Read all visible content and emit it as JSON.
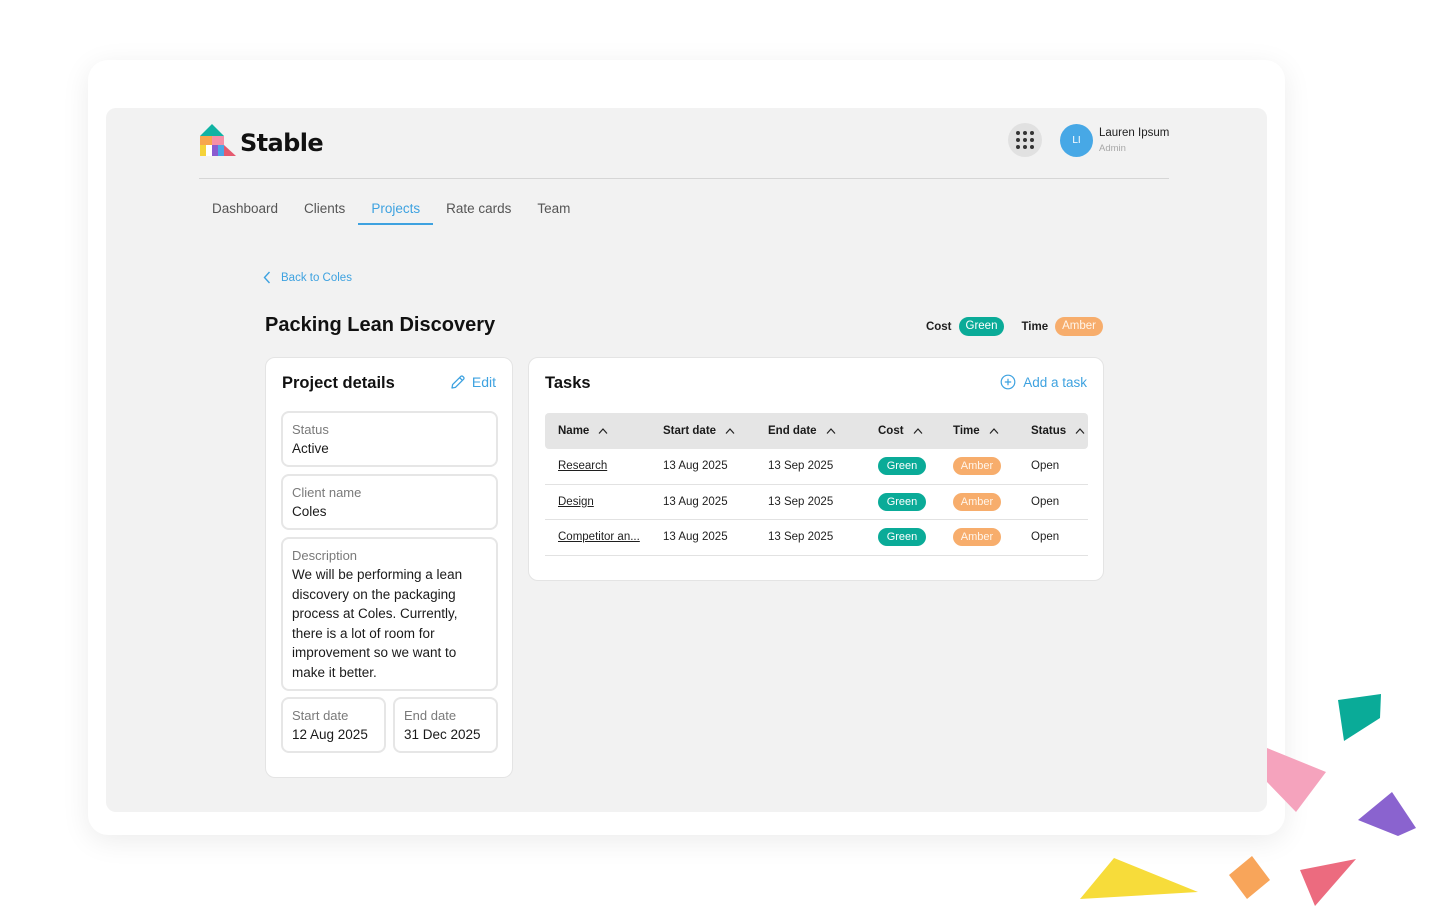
{
  "brand": {
    "name": "Stable",
    "colors": {
      "blue": "#3ea2e0",
      "green": "#0aab98",
      "amber": "#f7ad6c"
    }
  },
  "header": {
    "apps_icon": "grid-dots-icon",
    "user": {
      "initials": "LI",
      "name": "Lauren Ipsum",
      "role": "Admin"
    }
  },
  "nav": {
    "items": [
      {
        "label": "Dashboard",
        "active": false
      },
      {
        "label": "Clients",
        "active": false
      },
      {
        "label": "Projects",
        "active": true
      },
      {
        "label": "Rate cards",
        "active": false
      },
      {
        "label": "Team",
        "active": false
      }
    ]
  },
  "breadcrumb": {
    "back_label": "Back to Coles",
    "icon": "chevron-left-icon"
  },
  "project": {
    "title": "Packing Lean Discovery",
    "rag": {
      "cost_label": "Cost",
      "cost_value": "Green",
      "time_label": "Time",
      "time_value": "Amber"
    }
  },
  "details": {
    "title": "Project details",
    "edit_label": "Edit",
    "edit_icon": "pencil-icon",
    "status": {
      "label": "Status",
      "value": "Active"
    },
    "client": {
      "label": "Client name",
      "value": "Coles"
    },
    "description": {
      "label": "Description",
      "value": "We will be performing a lean discovery on the packaging process at Coles. Currently, there is a lot of room for improvement so we want to make it better."
    },
    "start_date": {
      "label": "Start date",
      "value": "12 Aug 2025"
    },
    "end_date": {
      "label": "End date",
      "value": "31 Dec 2025"
    }
  },
  "tasks": {
    "title": "Tasks",
    "add_label": "Add a task",
    "add_icon": "plus-circle-icon",
    "columns": [
      "Name",
      "Start date",
      "End date",
      "Cost",
      "Time",
      "Status"
    ],
    "rows": [
      {
        "name": "Research",
        "start": "13 Aug 2025",
        "end": "13 Sep 2025",
        "cost": "Green",
        "time": "Amber",
        "status": "Open"
      },
      {
        "name": "Design",
        "start": "13 Aug 2025",
        "end": "13 Sep 2025",
        "cost": "Green",
        "time": "Amber",
        "status": "Open"
      },
      {
        "name": "Competitor an...",
        "start": "13 Aug 2025",
        "end": "13 Sep 2025",
        "cost": "Green",
        "time": "Amber",
        "status": "Open"
      }
    ]
  }
}
